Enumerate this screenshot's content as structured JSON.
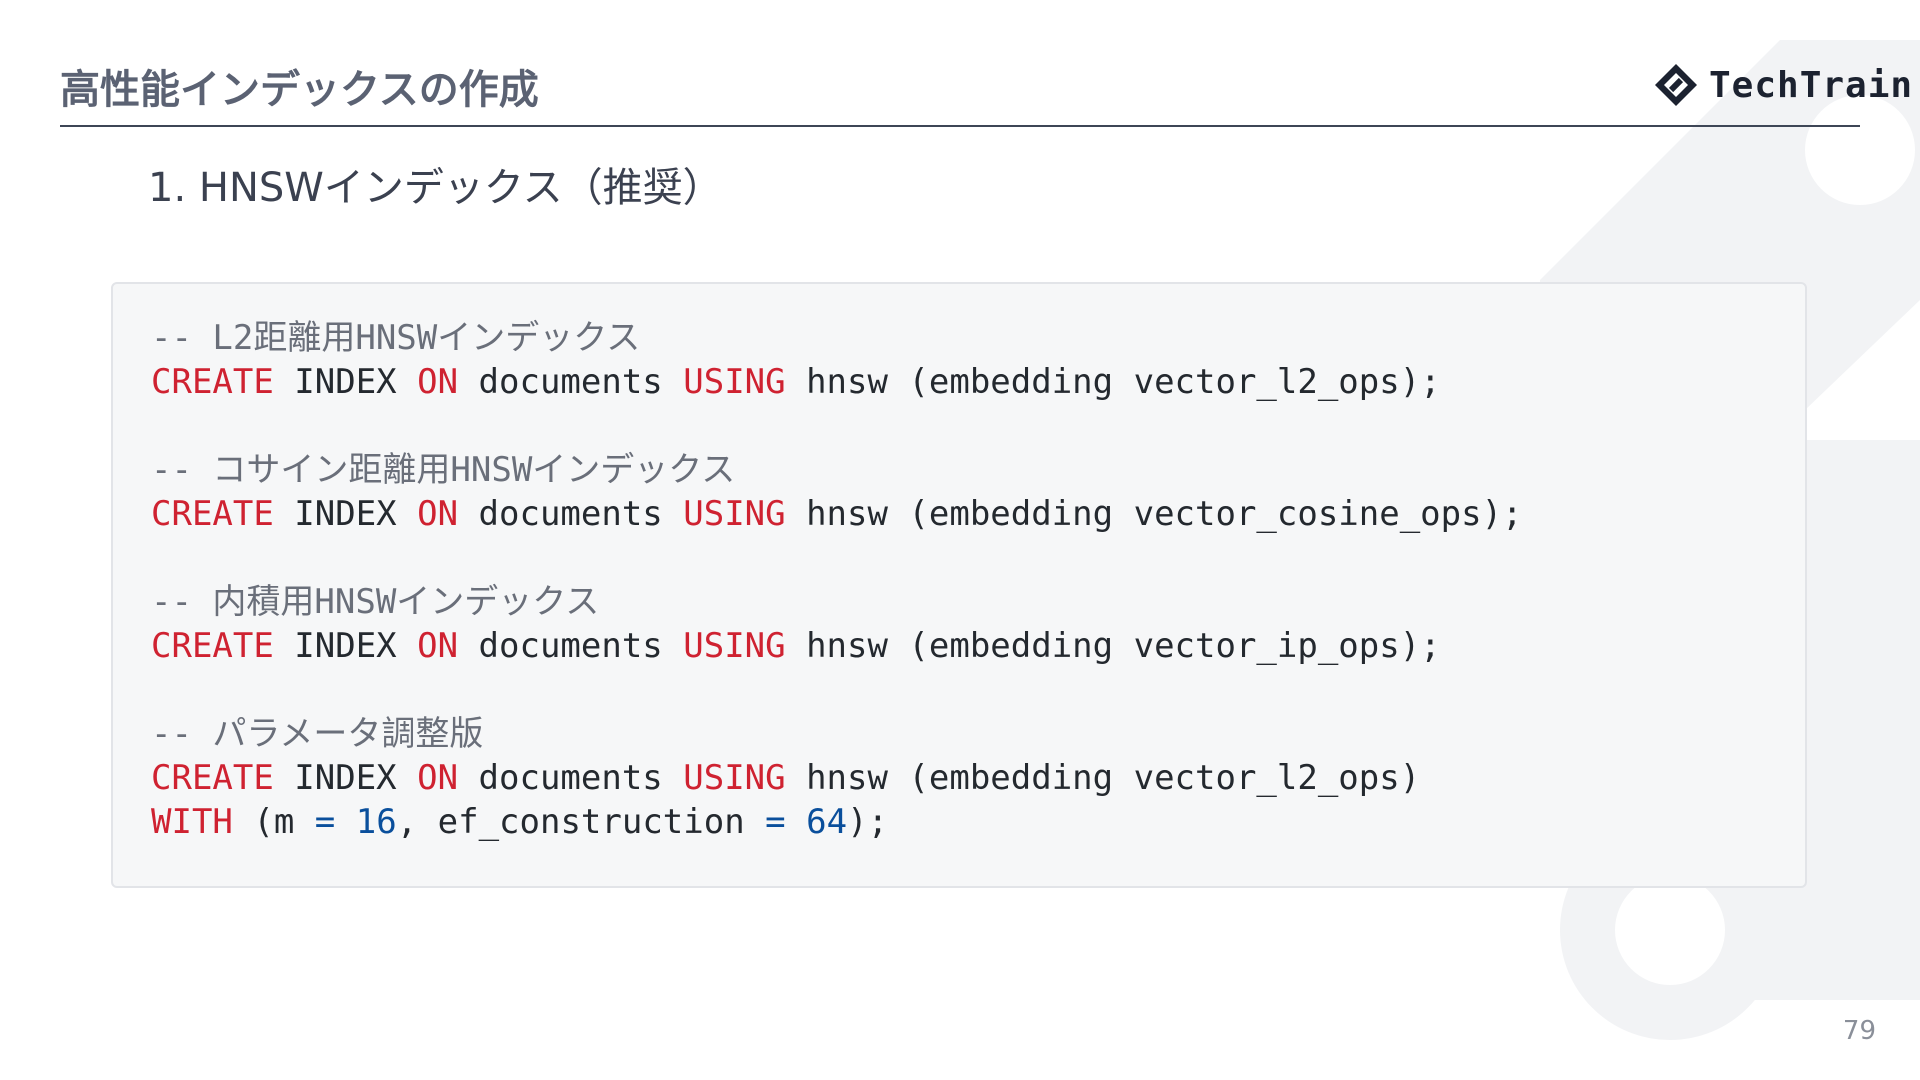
{
  "slide": {
    "title": "高性能インデックスの作成",
    "brand_name": "TechTrain",
    "section_heading": "1. HNSWインデックス（推奨）",
    "page_number": "79"
  },
  "colors": {
    "title": "#5b6273",
    "keyword": "#cf2231",
    "comment": "#6a6f7a",
    "number": "#0a4f9c",
    "code_background": "#f6f7f8",
    "decoration": "#f2f3f5"
  },
  "icons": {
    "brand_logo": "techtrain-logo-icon"
  },
  "code": {
    "language": "SQL",
    "lines": [
      {
        "tokens": [
          {
            "type": "comment",
            "text": "-- L2距離用HNSWインデックス"
          }
        ]
      },
      {
        "tokens": [
          {
            "type": "keyword",
            "text": "CREATE"
          },
          {
            "type": "plain",
            "text": " INDEX "
          },
          {
            "type": "keyword",
            "text": "ON"
          },
          {
            "type": "plain",
            "text": " documents "
          },
          {
            "type": "keyword",
            "text": "USING"
          },
          {
            "type": "plain",
            "text": " hnsw (embedding vector_l2_ops);"
          }
        ]
      },
      {
        "tokens": []
      },
      {
        "tokens": [
          {
            "type": "comment",
            "text": "-- コサイン距離用HNSWインデックス"
          }
        ]
      },
      {
        "tokens": [
          {
            "type": "keyword",
            "text": "CREATE"
          },
          {
            "type": "plain",
            "text": " INDEX "
          },
          {
            "type": "keyword",
            "text": "ON"
          },
          {
            "type": "plain",
            "text": " documents "
          },
          {
            "type": "keyword",
            "text": "USING"
          },
          {
            "type": "plain",
            "text": " hnsw (embedding vector_cosine_ops);"
          }
        ]
      },
      {
        "tokens": []
      },
      {
        "tokens": [
          {
            "type": "comment",
            "text": "-- 内積用HNSWインデックス"
          }
        ]
      },
      {
        "tokens": [
          {
            "type": "keyword",
            "text": "CREATE"
          },
          {
            "type": "plain",
            "text": " INDEX "
          },
          {
            "type": "keyword",
            "text": "ON"
          },
          {
            "type": "plain",
            "text": " documents "
          },
          {
            "type": "keyword",
            "text": "USING"
          },
          {
            "type": "plain",
            "text": " hnsw (embedding vector_ip_ops);"
          }
        ]
      },
      {
        "tokens": []
      },
      {
        "tokens": [
          {
            "type": "comment",
            "text": "-- パラメータ調整版"
          }
        ]
      },
      {
        "tokens": [
          {
            "type": "keyword",
            "text": "CREATE"
          },
          {
            "type": "plain",
            "text": " INDEX "
          },
          {
            "type": "keyword",
            "text": "ON"
          },
          {
            "type": "plain",
            "text": " documents "
          },
          {
            "type": "keyword",
            "text": "USING"
          },
          {
            "type": "plain",
            "text": " hnsw (embedding vector_l2_ops)"
          }
        ]
      },
      {
        "tokens": [
          {
            "type": "keyword",
            "text": "WITH"
          },
          {
            "type": "plain",
            "text": " (m "
          },
          {
            "type": "operator",
            "text": "="
          },
          {
            "type": "plain",
            "text": " "
          },
          {
            "type": "number",
            "text": "16"
          },
          {
            "type": "plain",
            "text": ", ef_construction "
          },
          {
            "type": "operator",
            "text": "="
          },
          {
            "type": "plain",
            "text": " "
          },
          {
            "type": "number",
            "text": "64"
          },
          {
            "type": "plain",
            "text": ");"
          }
        ]
      }
    ]
  }
}
